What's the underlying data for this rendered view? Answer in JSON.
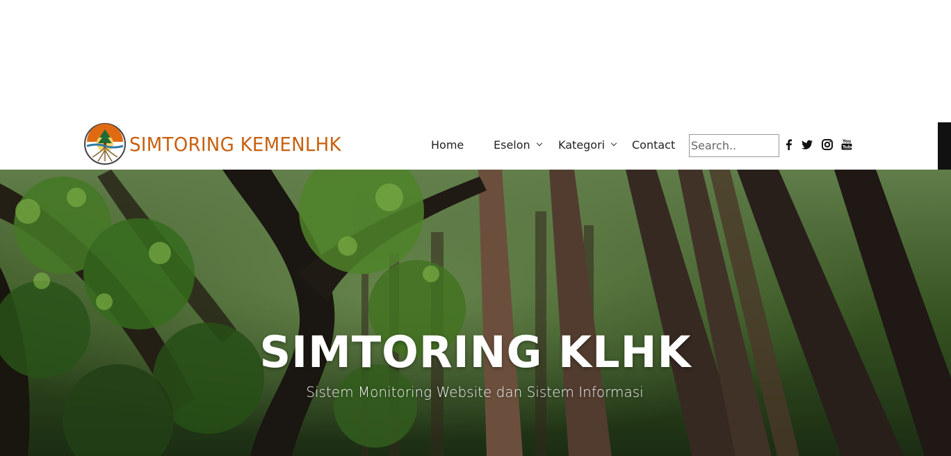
{
  "brand": {
    "name": "SIMTORING KEMENLHK",
    "logo_icon": "klhk-logo-icon"
  },
  "nav": {
    "items": [
      {
        "label": "Home",
        "has_dropdown": false
      },
      {
        "label": "Eselon",
        "has_dropdown": true
      },
      {
        "label": "Kategori",
        "has_dropdown": true
      },
      {
        "label": "Contact",
        "has_dropdown": false
      }
    ],
    "search": {
      "placeholder": "Search..",
      "value": ""
    },
    "social": [
      "facebook-icon",
      "twitter-icon",
      "instagram-icon",
      "youtube-icon"
    ]
  },
  "hero": {
    "title": "SIMTORING KLHK",
    "subtitle": "Sistem Monitoring Website dan Sistem Informasi"
  },
  "colors": {
    "brand": "#c8600f",
    "nav_text": "#222222",
    "hero_text": "#ffffff"
  }
}
